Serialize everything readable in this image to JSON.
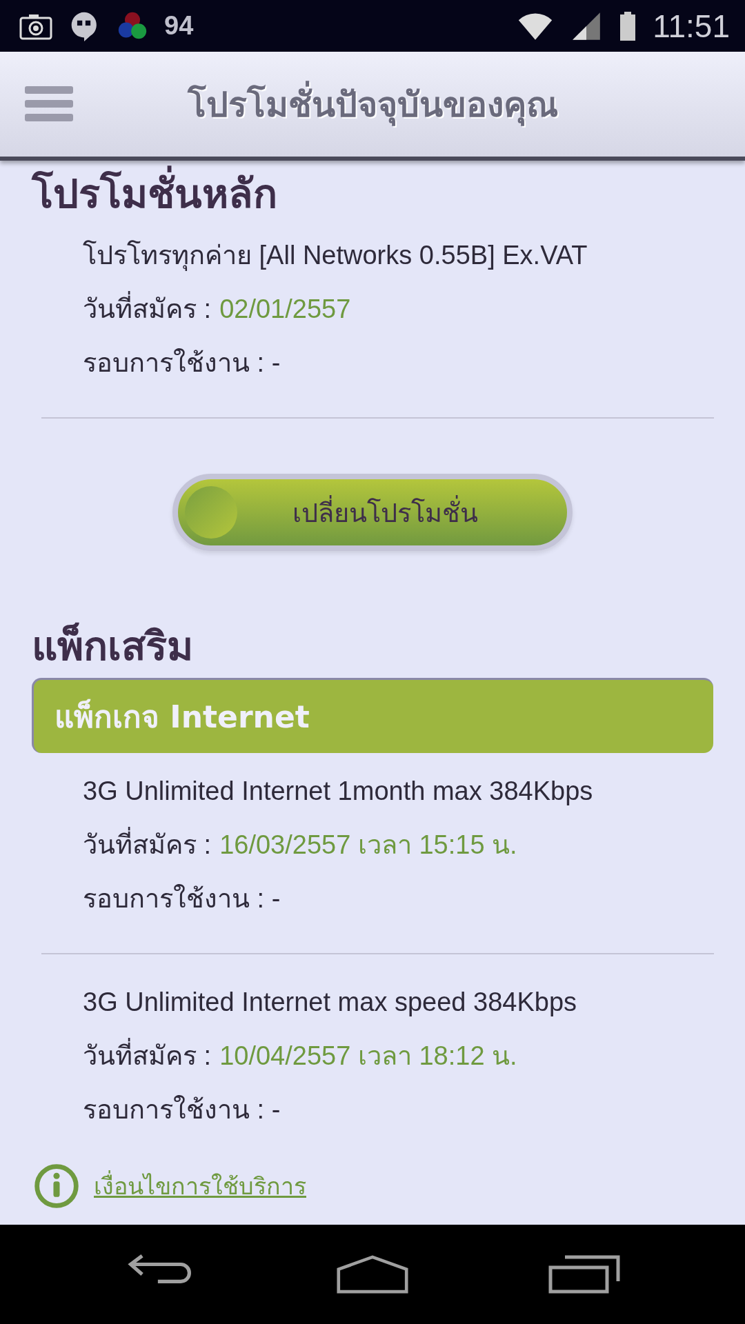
{
  "status_bar": {
    "notification_count": "94",
    "time": "11:51"
  },
  "header": {
    "title": "โปรโมชั่นปัจจุบันของคุณ"
  },
  "main_promotion": {
    "heading": "โปรโมชั่นหลัก",
    "items": [
      {
        "name": "โปรโทรทุกค่าย [All Networks 0.55B] Ex.VAT",
        "signup_label": "วันที่สมัคร :",
        "signup_value": "02/01/2557",
        "cycle": "รอบการใช้งาน : -"
      }
    ]
  },
  "change_button": {
    "label": "เปลี่ยนโปรโมชั่น"
  },
  "addons": {
    "heading": "แพ็กเสริม",
    "group_title": "แพ็กเกจ Internet",
    "items": [
      {
        "name": "3G Unlimited Internet 1month max 384Kbps",
        "signup_label": "วันที่สมัคร :",
        "signup_value": "16/03/2557 เวลา 15:15 น.",
        "cycle": "รอบการใช้งาน : -"
      },
      {
        "name": "3G Unlimited Internet max speed 384Kbps",
        "signup_label": "วันที่สมัคร :",
        "signup_value": "10/04/2557 เวลา 18:12 น.",
        "cycle": "รอบการใช้งาน : -"
      }
    ]
  },
  "terms_link": "เงื่อนไขการใช้บริการ"
}
